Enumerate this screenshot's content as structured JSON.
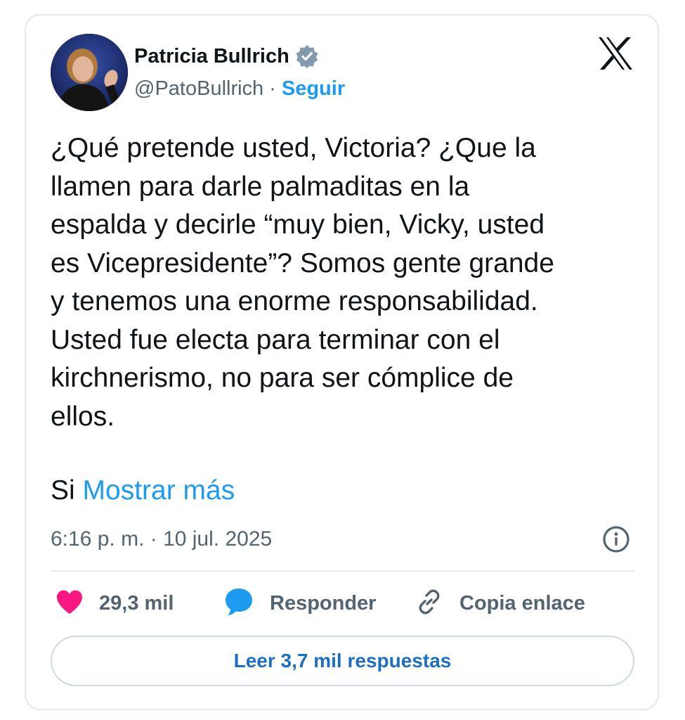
{
  "tweet": {
    "author": {
      "name": "Patricia Bullrich",
      "handle": "@PatoBullrich",
      "separator": "·",
      "follow_label": "Seguir",
      "verified_color": "#829aab"
    },
    "text_lines": [
      "¿Qué pretende usted, Victoria? ¿Que la",
      "llamen para darle palmaditas en la",
      "espalda y decirle “muy bien, Vicky, usted",
      "es Vicepresidente”? Somos gente grande",
      "y tenemos una enorme responsabilidad.",
      "Usted fue electa para terminar con el",
      "kirchnerismo, no para ser cómplice de",
      "ellos."
    ],
    "truncated_text": "Si",
    "show_more_label": "Mostrar más",
    "timestamp": "6:16 p. m. · 10 jul. 2025",
    "actions": {
      "likes": "29,3 mil",
      "reply": "Responder",
      "copy_link": "Copia enlace"
    },
    "read_replies_label": "Leer 3,7 mil respuestas"
  },
  "icons": {
    "platform": "x-logo-icon",
    "verified": "verified-badge-icon",
    "info": "info-icon",
    "like": "heart-icon",
    "reply": "speech-bubble-icon",
    "copy": "link-icon"
  },
  "colors": {
    "accent": "#1d9bf0",
    "heart": "#f91880",
    "text": "#0f1419",
    "muted": "#536471"
  }
}
